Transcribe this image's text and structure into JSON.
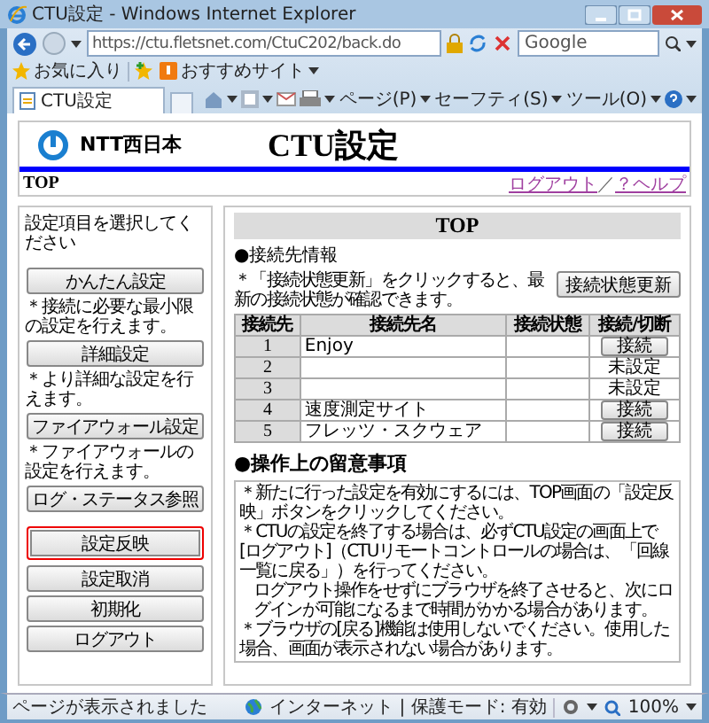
{
  "window": {
    "title": "CTU設定 - Windows Internet Explorer"
  },
  "address_bar": {
    "url": "https://ctu.fletsnet.com/CtuC202/back.do"
  },
  "search": {
    "placeholder": "Google"
  },
  "favorites_bar": {
    "favorites": "お気に入り",
    "suggested_sites": "おすすめサイト"
  },
  "tabs": [
    {
      "label": "CTU設定",
      "selected": true
    }
  ],
  "command_bar": [
    {
      "label": "ページ(P)"
    },
    {
      "label": "セーフティ(S)"
    },
    {
      "label": "ツール(O)"
    }
  ],
  "header": {
    "logo_text": "NTT西日本",
    "title": "CTU設定",
    "breadcrumb": "TOP",
    "links": [
      {
        "label": "ログアウト"
      },
      {
        "label": "？ヘルプ"
      }
    ],
    "link_separator": "／"
  },
  "sidebar": {
    "prompt": "設定項目を選択してください",
    "items": [
      {
        "kind": "button",
        "label": "かんたん設定",
        "highlighted": false
      },
      {
        "kind": "note",
        "text": "＊接続に必要な最小限の設定を行えます。"
      },
      {
        "kind": "button",
        "label": "詳細設定",
        "highlighted": false
      },
      {
        "kind": "note",
        "text": "＊より詳細な設定を行えます。"
      },
      {
        "kind": "button",
        "label": "ファイアウォール設定",
        "highlighted": false
      },
      {
        "kind": "note",
        "text": "＊ファイアウォールの設定を行えます。"
      },
      {
        "kind": "button",
        "label": "ログ・ステータス参照",
        "highlighted": false
      },
      {
        "kind": "button",
        "label": "設定反映",
        "highlighted": true
      },
      {
        "kind": "button",
        "label": "設定取消",
        "highlighted": false
      },
      {
        "kind": "button",
        "label": "初期化",
        "highlighted": false
      },
      {
        "kind": "button",
        "label": "ログアウト",
        "highlighted": false
      }
    ]
  },
  "main": {
    "title": "TOP",
    "connection_section": {
      "heading": "●接続先情報",
      "note": "＊「接続状態更新」をクリックすると、最新の接続状態が確認できます。",
      "refresh_button": "接続状態更新"
    },
    "table": {
      "columns": [
        "接続先",
        "接続先名",
        "接続状態",
        "接続/切断"
      ],
      "rows": [
        {
          "number": "1",
          "name": "Enjoy",
          "action": {
            "kind": "button",
            "label": "接続"
          }
        },
        {
          "number": "2",
          "action": {
            "kind": "text",
            "label": "未設定"
          }
        },
        {
          "number": "3",
          "action": {
            "kind": "text",
            "label": "未設定"
          }
        },
        {
          "number": "4",
          "name": "速度測定サイト",
          "action": {
            "kind": "button",
            "label": "接続"
          }
        },
        {
          "number": "5",
          "name": "フレッツ・スクウェア",
          "action": {
            "kind": "button",
            "label": "接続"
          }
        }
      ]
    },
    "notices_heading": "●操作上の留意事項",
    "notices": [
      {
        "kind": "bullet",
        "text": "＊新たに行った設定を有効にするには、TOP画面の「設定反映」ボタンをクリックしてください。"
      },
      {
        "kind": "bullet",
        "text": "＊CTUの設定を終了する場合は、必ずCTU設定の画面上で[ログアウト]（CTUリモートコントロールの場合は、「回線一覧に戻る」）を行ってください。"
      },
      {
        "kind": "continuation",
        "text": "ログアウト操作をせずにブラウザを終了させると、次にログインが可能になるまで時間がかかる場合があります。"
      },
      {
        "kind": "bullet",
        "text": "＊ブラウザの[戻る]機能は使用しないでください。使用した場合、画面が表示されない場合があります。"
      }
    ]
  },
  "status_bar": {
    "message": "ページが表示されました",
    "zone": "インターネット | 保護モード: 有効",
    "zoom": "100%"
  }
}
